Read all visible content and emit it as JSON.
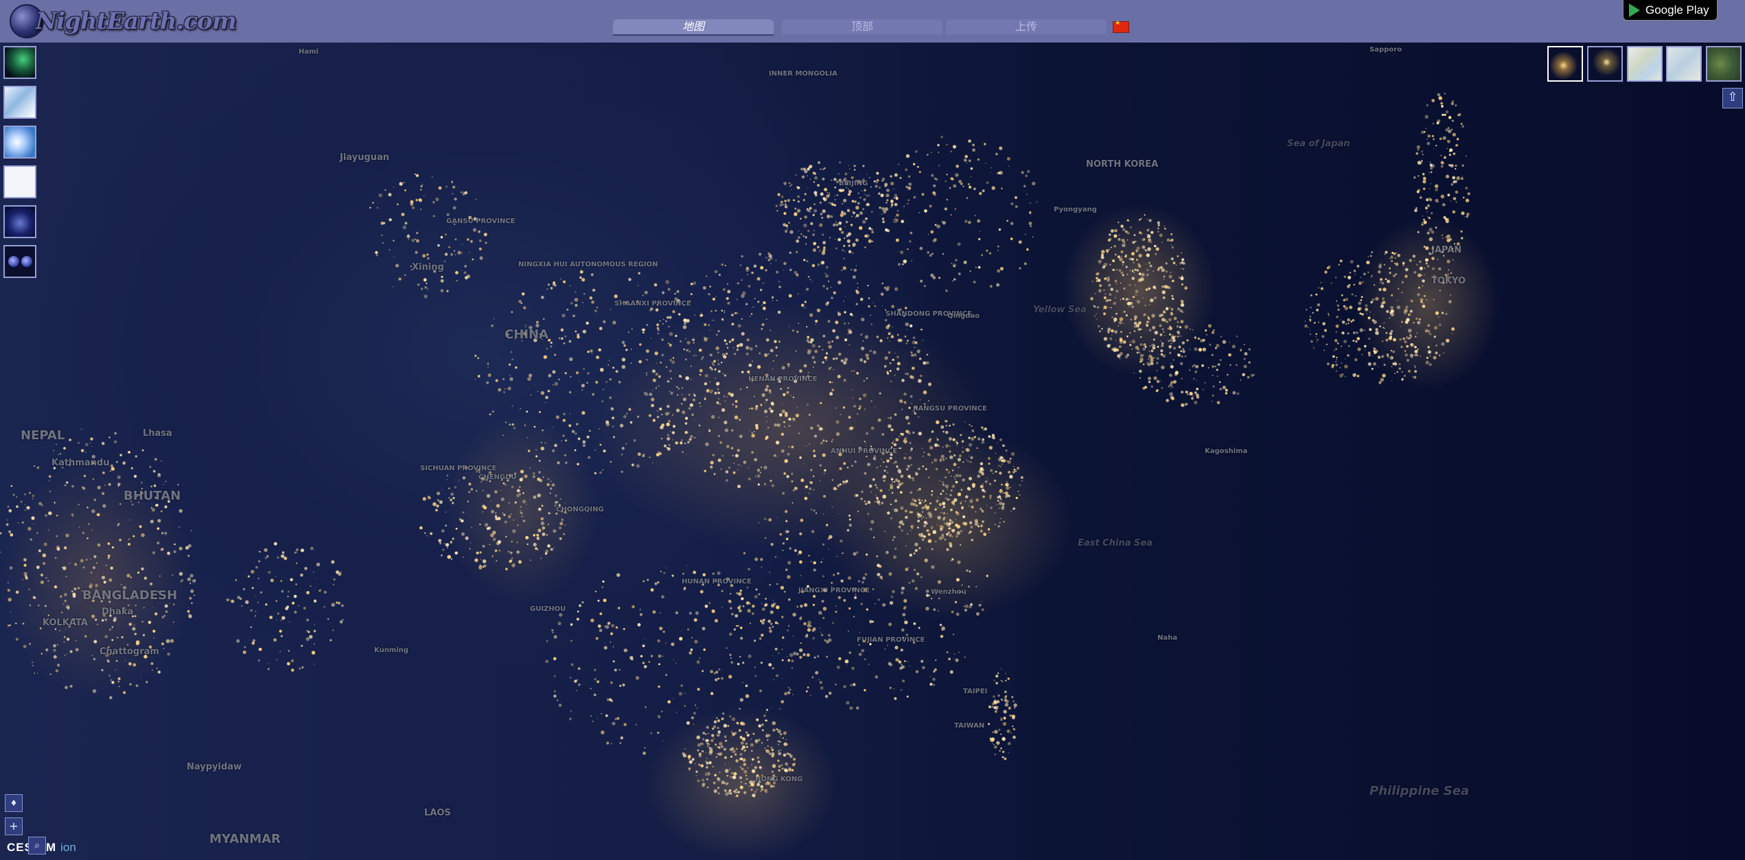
{
  "header": {
    "logo_text": "NightEarth.com",
    "tabs": [
      {
        "label": "地图",
        "active": true
      },
      {
        "label": "顶部",
        "active": false
      },
      {
        "label": "上传",
        "active": false
      }
    ],
    "language_flag": "cn-flag-icon",
    "google_play_label": "Google Play"
  },
  "left_layers": [
    {
      "name": "aurora-layer-icon"
    },
    {
      "name": "terrain-layer-icon"
    },
    {
      "name": "clouds-layer-icon"
    },
    {
      "name": "white-layer-icon"
    },
    {
      "name": "night-globe-layer-icon"
    },
    {
      "name": "dual-globe-layer-icon"
    }
  ],
  "right_styles": [
    {
      "name": "night-lights-style",
      "selected": true
    },
    {
      "name": "night-labels-style",
      "selected": false
    },
    {
      "name": "map-light-style",
      "selected": false
    },
    {
      "name": "map-terrain-style",
      "selected": false
    },
    {
      "name": "satellite-style",
      "selected": false
    }
  ],
  "home_button": "⇧",
  "controls": {
    "compass": "♦",
    "zoom_in": "+",
    "zoom_out": "−",
    "search": "⌕",
    "credit_main": "CESIUM",
    "credit_sub": "ion"
  },
  "map_labels": {
    "mongolia": "INNER MONGOLIA",
    "jiayuguan": "Jiayuguan",
    "xining": "Xining",
    "gansu": "GANSU PROVINCE",
    "ningxia": "NINGXIA HUI AUTONOMOUS REGION",
    "shaanxi": "SHAANXI PROVINCE",
    "china": "CHINA",
    "sichuan": "SICHUAN PROVINCE",
    "chengdu": "CHENGDU",
    "chongqing": "CHONGQING",
    "guizhou": "GUIZHOU",
    "hunan": "HUNAN PROVINCE",
    "jiangxi": "JIANGXI PROVINCE",
    "fujian": "FUJIAN PROVINCE",
    "taiwan": "TAIWAN",
    "taipei": "TAIPEI",
    "hongkong": "HONG KONG",
    "nepal": "NEPAL",
    "bhutan": "BHUTAN",
    "lhasa": "Lhasa",
    "kathmandu": "Kathmandu",
    "bangladesh": "BANGLADESH",
    "dhaka": "Dhaka",
    "kolkata": "KOLKATA",
    "chattogram": "Chattogram",
    "naypyidaw": "Naypyidaw",
    "myanmar": "MYANMAR",
    "laos": "LAOS",
    "beijing": "BEIJING",
    "shandong": "SHANDONG PROVINCE",
    "qingdao": "Qingdao",
    "anhui": "ANHUI PROVINCE",
    "henan": "HENAN PROVINCE",
    "jiangsu": "JIANGSU PROVINCE",
    "wenzhou": "Wenzhou",
    "north_korea": "NORTH KOREA",
    "pyongyang": "Pyongyang",
    "yellow_sea": "Yellow Sea",
    "east_china_sea": "East China Sea",
    "sea_of_japan": "Sea of Japan",
    "tokyo": "TOKYO",
    "japan": "JAPAN",
    "sapporo": "Sapporo",
    "kagoshima": "Kagoshima",
    "naha": "Naha",
    "philippine": "Philippine Sea",
    "hami": "Hami",
    "kunming": "Kunming"
  }
}
